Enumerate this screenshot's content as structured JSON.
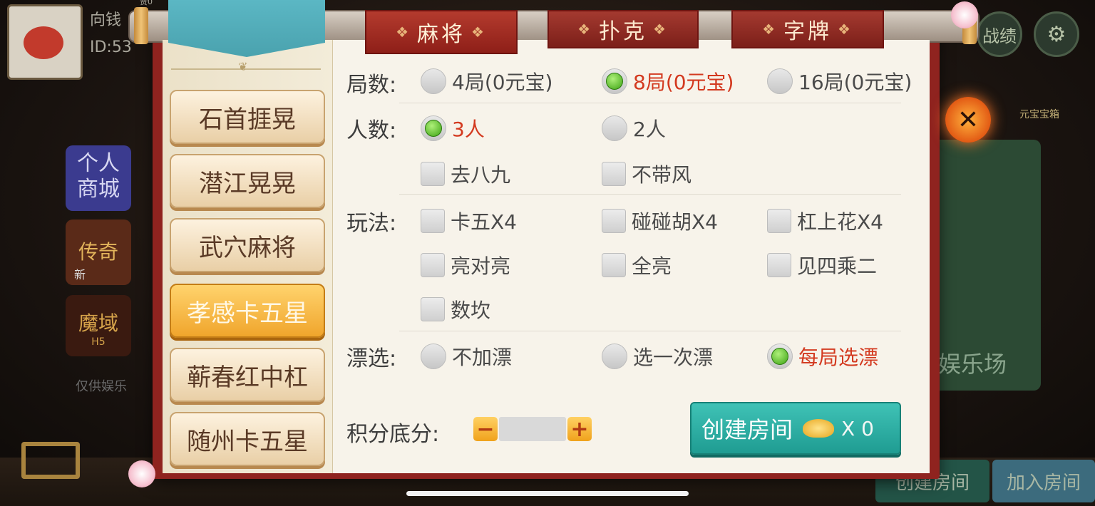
{
  "background": {
    "player_name": "向钱",
    "player_id": "ID:53",
    "coin_tag": "赞0",
    "shop_tile": "个人\n商城",
    "game_tile_1": "传奇",
    "game_tile_1_badge": "新",
    "game_tile_2": "魔域",
    "game_tile_2_sub": "H5",
    "disclaimer": "仅供娱乐",
    "treasure_label": "元宝宝箱",
    "right_tile_label": "娱乐场",
    "btn_create_room": "创建房间",
    "btn_join_room": "加入房间",
    "top_right_label": "战绩"
  },
  "tabs": [
    {
      "label": "麻将",
      "active": true
    },
    {
      "label": "扑克",
      "active": false
    },
    {
      "label": "字牌",
      "active": false
    }
  ],
  "games": [
    {
      "label": "石首捱晃",
      "selected": false
    },
    {
      "label": "潜江晃晃",
      "selected": false
    },
    {
      "label": "武穴麻将",
      "selected": false
    },
    {
      "label": "孝感卡五星",
      "selected": true
    },
    {
      "label": "蕲春红中杠",
      "selected": false
    },
    {
      "label": "随州卡五星",
      "selected": false
    }
  ],
  "rounds": {
    "label": "局数:",
    "options": [
      {
        "label": "4局(0元宝)",
        "selected": false
      },
      {
        "label": "8局(0元宝)",
        "selected": true
      },
      {
        "label": "16局(0元宝)",
        "selected": false
      }
    ]
  },
  "players": {
    "label": "人数:",
    "options": [
      {
        "label": "3人",
        "selected": true
      },
      {
        "label": "2人",
        "selected": false
      }
    ],
    "extras": [
      {
        "label": "去八九",
        "checked": false
      },
      {
        "label": "不带风",
        "checked": false
      }
    ]
  },
  "rules": {
    "label": "玩法:",
    "options": [
      {
        "label": "卡五X4",
        "checked": false
      },
      {
        "label": "碰碰胡X4",
        "checked": false
      },
      {
        "label": "杠上花X4",
        "checked": false
      },
      {
        "label": "亮对亮",
        "checked": false
      },
      {
        "label": "全亮",
        "checked": false
      },
      {
        "label": "见四乘二",
        "checked": false
      },
      {
        "label": "数坎",
        "checked": false
      }
    ]
  },
  "piao": {
    "label": "漂选:",
    "options": [
      {
        "label": "不加漂",
        "selected": false
      },
      {
        "label": "选一次漂",
        "selected": false
      },
      {
        "label": "每局选漂",
        "selected": true
      }
    ]
  },
  "score": {
    "label": "积分底分:",
    "minus": "−",
    "plus": "+",
    "value": ""
  },
  "create_button": {
    "label": "创建房间",
    "multiplier": "X 0"
  },
  "close_button": {
    "symbol": "✕"
  },
  "colors": {
    "accent_red": "#d3391f",
    "tab_red": "#8e1f18",
    "create_teal": "#1f9c92",
    "selected_gold": "#f0a52c"
  }
}
